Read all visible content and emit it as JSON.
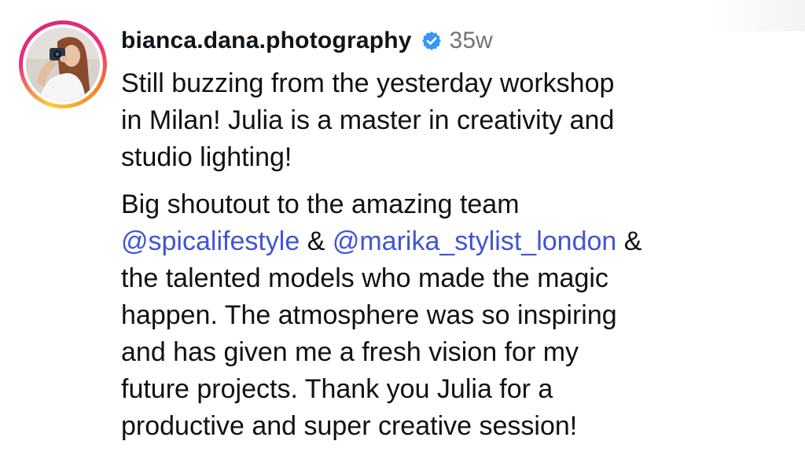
{
  "post": {
    "username": "bianca.dana.photography",
    "verified_icon": "verified-badge-icon",
    "verified_color": "#3897f0",
    "timestamp": "35w",
    "caption_para1": [
      "Still buzzing from the yesterday workshop",
      "in Milan! Julia is a master in creativity and",
      "studio lighting!"
    ],
    "caption_para2": {
      "line1": "Big shoutout to the amazing team",
      "mention1": "@spicalifestyle",
      "amp1": " & ",
      "mention2": "@marika_stylist_london",
      "amp2": " &",
      "lines": [
        "the talented models who made the magic",
        "happen. The atmosphere was so inspiring",
        "and has given me a fresh vision for my",
        "future projects. Thank you Julia for a",
        "productive and super creative session!"
      ]
    },
    "mention_color": "#4054d6",
    "story_ring_colors": [
      "#f9ce34",
      "#ee2a7b",
      "#d62976",
      "#f58529"
    ]
  }
}
